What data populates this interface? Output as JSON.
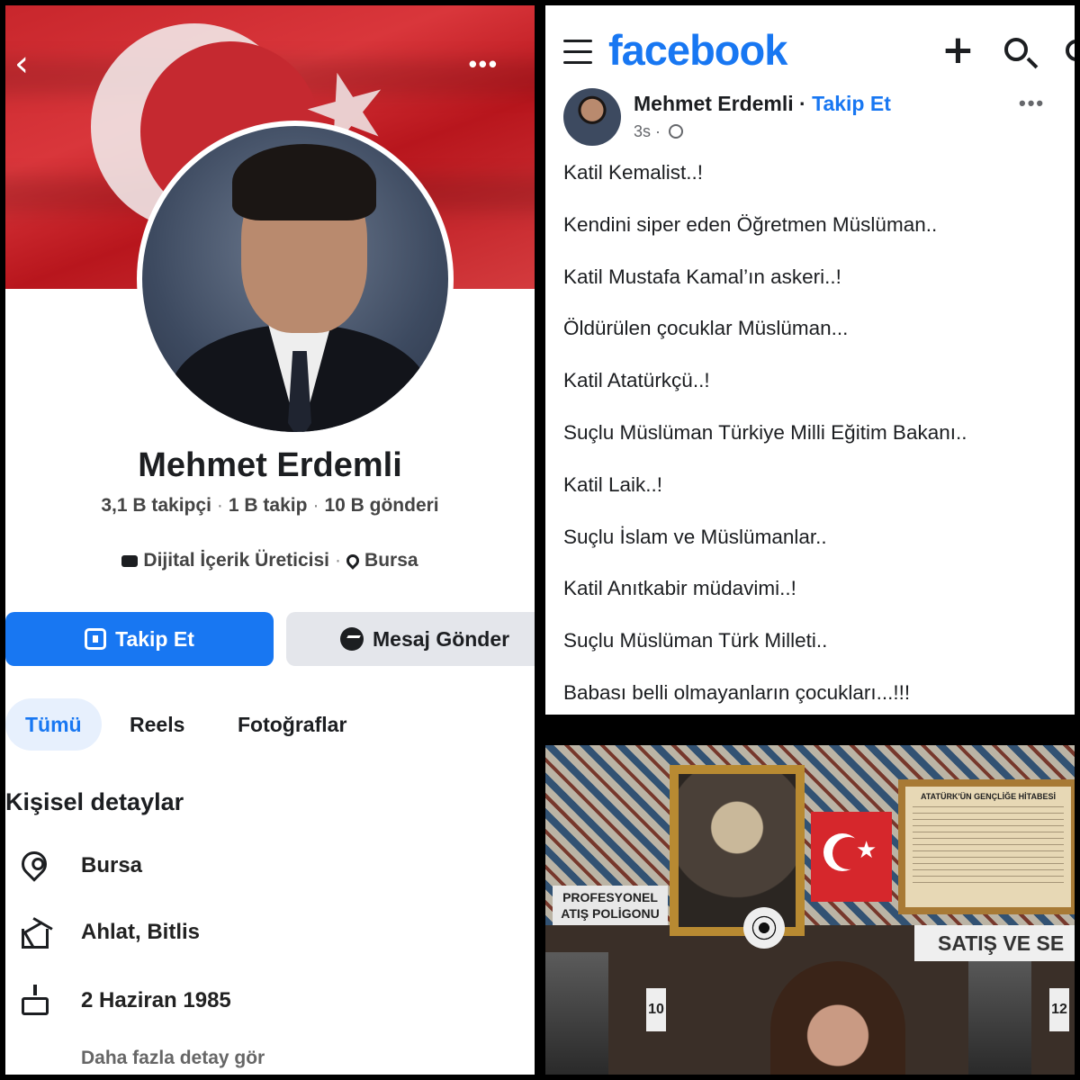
{
  "profile": {
    "name": "Mehmet Erdemli",
    "stats": {
      "followers": "3,1 B takipçi",
      "following": "1 B takip",
      "posts": "10 B gönderi"
    },
    "category": "Dijital İçerik Üreticisi",
    "location": "Bursa",
    "follow_button": "Takip Et",
    "message_button": "Mesaj Gönder",
    "tabs": [
      {
        "label": "Tümü",
        "active": true
      },
      {
        "label": "Reels",
        "active": false
      },
      {
        "label": "Fotoğraflar",
        "active": false
      }
    ],
    "details_title": "Kişisel detaylar",
    "details": [
      {
        "icon": "location-pin-icon",
        "text": "Bursa"
      },
      {
        "icon": "home-icon",
        "text": "Ahlat, Bitlis"
      },
      {
        "icon": "birthday-cake-icon",
        "text": "2 Haziran 1985"
      }
    ],
    "more_details_link": "Daha fazla detay gör",
    "cover_colors": {
      "flag_red": "#c8262c",
      "follow_blue": "#1877f2"
    }
  },
  "post": {
    "app_logo": "facebook",
    "author": "Mehmet Erdemli",
    "separator": " · ",
    "follow_link": "Takip Et",
    "time": "3s",
    "time_separator": " · ",
    "lines": [
      "Katil Kemalist..!",
      "Kendini siper eden Öğretmen Müslüman..",
      "Katil Mustafa Kamal’ın askeri..!",
      "Öldürülen çocuklar Müslüman...",
      "Katil Atatürkçü..!",
      "Suçlu Müslüman Türkiye Milli Eğitim Bakanı..",
      "Katil Laik..!",
      "Suçlu İslam ve Müslümanlar..",
      "Katil Anıtkabir müdavimi..!",
      "Suçlu Müslüman Türk Milleti..",
      "Babası belli olmayanların çocukları...!!!"
    ]
  },
  "photo": {
    "hitabe_title": "ATATÜRK'ÜN GENÇLİĞE HİTABESİ",
    "poligon_sign": "PROFESYONEL ATIŞ POLİGONU",
    "sales_sign": "SATIŞ VE SE",
    "lane_numbers": [
      "10",
      "12"
    ]
  }
}
